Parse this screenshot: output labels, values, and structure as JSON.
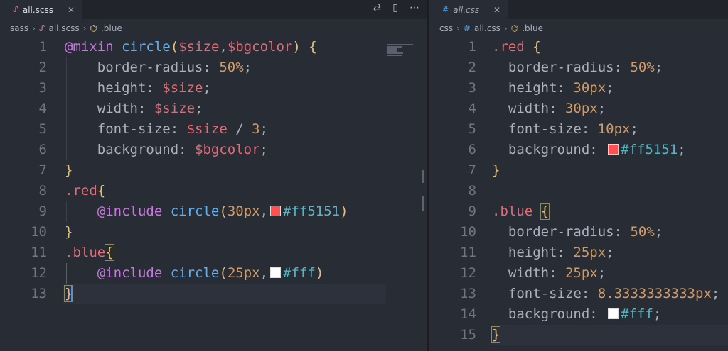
{
  "left": {
    "tab": {
      "label": "all.scss",
      "icon": "sass-file-icon",
      "close": "✕"
    },
    "actions": [
      {
        "name": "compare-changes-icon",
        "glyph": "⇄"
      },
      {
        "name": "split-editor-icon",
        "glyph": "▯"
      },
      {
        "name": "more-actions-icon",
        "glyph": "⋯"
      }
    ],
    "breadcrumb": [
      "sass",
      "all.scss",
      ".blue"
    ],
    "lines": [
      "@mixin circle($size,$bgcolor) {",
      "    border-radius: 50%;",
      "    height: $size;",
      "    width: $size;",
      "    font-size: $size / 3;",
      "    background: $bgcolor;",
      "}",
      ".red{",
      "    @include circle(30px,#ff5151)",
      "}",
      ".blue{",
      "    @include circle(25px,#fff)",
      "}"
    ]
  },
  "right": {
    "tab": {
      "label": "all.css",
      "icon": "css-file-icon",
      "close": "✕"
    },
    "breadcrumb": [
      "css",
      "all.css",
      ".blue"
    ],
    "lines": [
      ".red {",
      "  border-radius: 50%;",
      "  height: 30px;",
      "  width: 30px;",
      "  font-size: 10px;",
      "  background: #ff5151;",
      "}",
      "",
      ".blue {",
      "  border-radius: 50%;",
      "  height: 25px;",
      "  width: 25px;",
      "  font-size: 8.3333333333px;",
      "  background: #fff;",
      "}"
    ]
  },
  "colors": {
    "red_swatch": "#ff5151",
    "white_swatch": "#ffffff",
    "accent": "#528bff"
  }
}
